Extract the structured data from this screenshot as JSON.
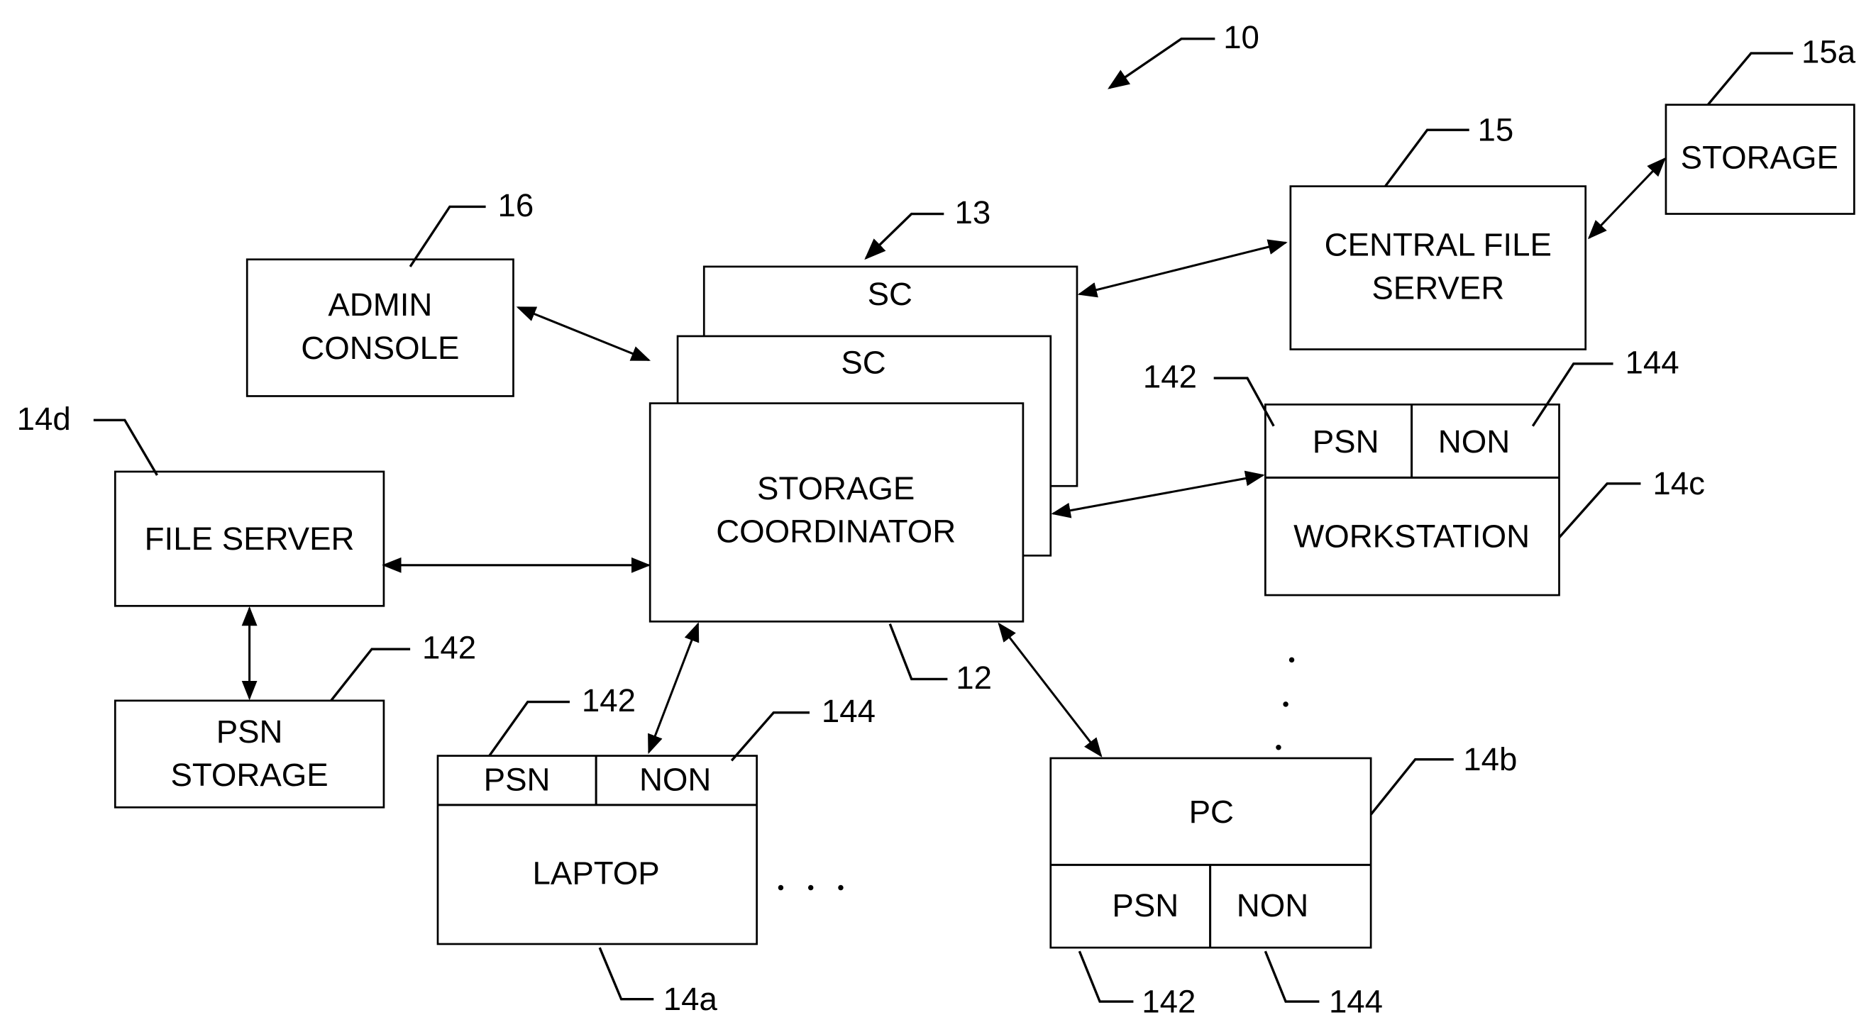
{
  "figure_ref": "10",
  "nodes": {
    "admin_console": {
      "lines": [
        "ADMIN",
        "CONSOLE"
      ],
      "ref": "16"
    },
    "sc_back": {
      "label": "SC",
      "ref": "13"
    },
    "sc_mid": {
      "label": "SC"
    },
    "storage_coordinator": {
      "lines": [
        "STORAGE",
        "COORDINATOR"
      ],
      "ref": "12"
    },
    "central_file_server": {
      "lines": [
        "CENTRAL FILE",
        "SERVER"
      ],
      "ref": "15"
    },
    "storage": {
      "label": "STORAGE",
      "ref": "15a"
    },
    "file_server": {
      "label": "FILE SERVER",
      "ref": "14d"
    },
    "psn_storage": {
      "lines": [
        "PSN",
        "STORAGE"
      ],
      "ref": "142"
    },
    "workstation": {
      "label": "WORKSTATION",
      "psn": "PSN",
      "non": "NON",
      "ref": "14c",
      "psn_ref": "142",
      "non_ref": "144"
    },
    "laptop": {
      "label": "LAPTOP",
      "psn": "PSN",
      "non": "NON",
      "ref": "14a",
      "psn_ref": "142",
      "non_ref": "144"
    },
    "pc": {
      "label": "PC",
      "psn": "PSN",
      "non": "NON",
      "ref": "14b",
      "psn_ref": "142",
      "non_ref": "144"
    }
  },
  "ellipsis": ". . ."
}
